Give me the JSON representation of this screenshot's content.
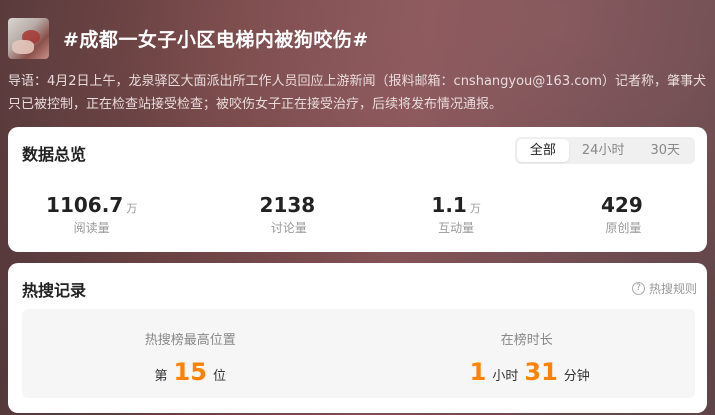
{
  "header": {
    "title": "#成都一女子小区电梯内被狗咬伤#",
    "thumbnail_icon": "topic-thumbnail-image"
  },
  "intro": "导语：4月2日上午，龙泉驿区大面派出所工作人员回应上游新闻（报料邮箱：cnshangyou@163.com）记者称，肇事犬只已被控制，正在检查站接受检查；被咬伤女子正在接受治疗，后续将发布情况通报。",
  "overview": {
    "title": "数据总览",
    "tabs": [
      {
        "label": "全部",
        "active": true
      },
      {
        "label": "24小时",
        "active": false
      },
      {
        "label": "30天",
        "active": false
      }
    ],
    "stats": [
      {
        "value": "1106.7",
        "unit": "万",
        "label": "阅读量"
      },
      {
        "value": "2138",
        "unit": "",
        "label": "讨论量"
      },
      {
        "value": "1.1",
        "unit": "万",
        "label": "互动量"
      },
      {
        "value": "429",
        "unit": "",
        "label": "原创量"
      }
    ]
  },
  "hot": {
    "title": "热搜记录",
    "rules_link": "热搜规则",
    "rules_icon": "question-circle-icon",
    "best_position": {
      "caption": "热搜榜最高位置",
      "prefix": "第",
      "value": "15",
      "suffix": "位"
    },
    "duration": {
      "caption": "在榜时长",
      "hours": "1",
      "hours_unit": "小时",
      "minutes": "31",
      "minutes_unit": "分钟"
    }
  },
  "colors": {
    "accent": "#ff8200",
    "card_bg": "#ffffff",
    "header_text": "#ffffff"
  }
}
